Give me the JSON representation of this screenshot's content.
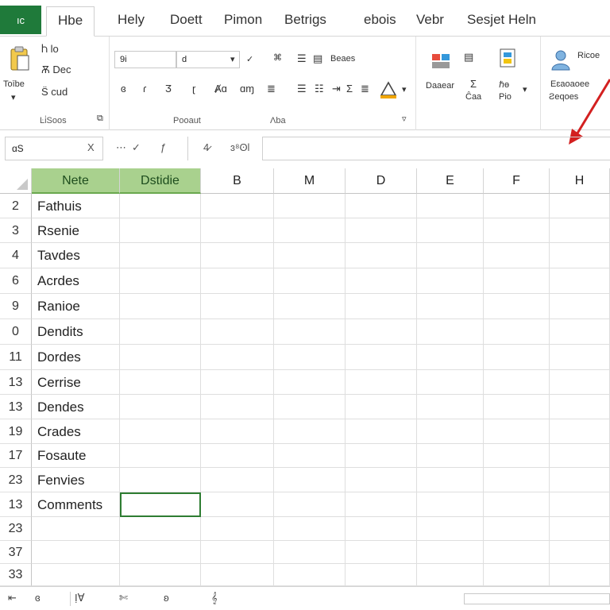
{
  "app": {
    "badge": "ıc"
  },
  "tabs": [
    "Hbe",
    "Hely",
    "Doett",
    "Pimon",
    "Betrigs",
    "ebois",
    "Vebr",
    "Sesjet Heln"
  ],
  "active_tab_index": 0,
  "ribbon": {
    "clipboard": {
      "paste_label": "Toībe",
      "cut": "Ⴙ lo",
      "copy": "Ѫ Dec",
      "format": "S̈ cud",
      "group_label": "Ŀi̇Soos"
    },
    "font": {
      "font_name": "9i",
      "font_size": "d",
      "group_label": "Pooaut",
      "tools_row1": [
        "ɞ",
        "ɾ",
        "Ӡ",
        "ɽ",
        "Ⱥɑ",
        "ɑɱ"
      ],
      "tools_row2": [
        "ɚ",
        "ɬ",
        "Ɣ",
        "ʝ",
        "ɜ"
      ]
    },
    "alignment": {
      "wrap_label": "Beaes",
      "group_label": "Ʌba"
    },
    "cells": {
      "insert": "Daaear",
      "sigma": "Σ",
      "sigma_sub": "Ĉaa",
      "fx": "ℏɵ",
      "fx_sub": "Pio"
    },
    "share": {
      "label1": "Ricoe",
      "label2": "Eɛaoaoee",
      "label3": "Ƨeqoes"
    }
  },
  "formula_bar": {
    "name_box": "ɑS",
    "cancel": "X",
    "confirm": "✓",
    "fx": "ƒ",
    "btn4": "4̷",
    "btn5": "ɜ⁸ʘl"
  },
  "columns": [
    {
      "label": "Nete",
      "selected": true
    },
    {
      "label": "Dstidie",
      "selected": true
    },
    {
      "label": "B",
      "selected": false
    },
    {
      "label": "M",
      "selected": false
    },
    {
      "label": "D",
      "selected": false
    },
    {
      "label": "E",
      "selected": false
    },
    {
      "label": "F",
      "selected": false
    },
    {
      "label": "H",
      "selected": false
    }
  ],
  "rows": [
    {
      "num": "2",
      "a": "Fathuis"
    },
    {
      "num": "3",
      "a": "Rsenie"
    },
    {
      "num": "4",
      "a": "Tavdes"
    },
    {
      "num": "6",
      "a": "Acrdes"
    },
    {
      "num": "9",
      "a": "Ranioe"
    },
    {
      "num": "0",
      "a": "Dendits"
    },
    {
      "num": "11",
      "a": "Dordes"
    },
    {
      "num": "13",
      "a": "Cerrise"
    },
    {
      "num": "13",
      "a": "Dendes"
    },
    {
      "num": "19",
      "a": "Crades"
    },
    {
      "num": "17",
      "a": "Fosaute"
    },
    {
      "num": "23",
      "a": "Fenvies"
    },
    {
      "num": "13",
      "a": "Comments"
    },
    {
      "num": "23",
      "a": ""
    },
    {
      "num": "37",
      "a": ""
    },
    {
      "num": "33",
      "a": ""
    }
  ],
  "sheetbar": {
    "items": [
      "⇤",
      "ɞ",
      "ỊⱯ",
      "✄",
      "ʚ",
      "𝄞"
    ]
  },
  "colors": {
    "accent": "#1f7a3a",
    "header_selected": "#a9d18e",
    "active_cell_border": "#2e7d32",
    "arrow": "#d32020"
  }
}
